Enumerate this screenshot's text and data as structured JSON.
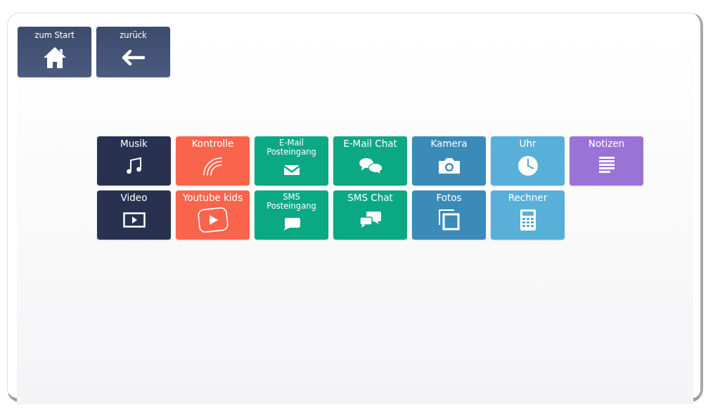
{
  "nav_buttons": [
    {
      "label": "zum Start",
      "kind": "home"
    },
    {
      "label": "zurück",
      "kind": "back"
    }
  ],
  "tile_rows": [
    [
      {
        "label": "Musik",
        "kind": "music",
        "color": "#283250"
      },
      {
        "label": "Kontrolle",
        "kind": "signal",
        "color": "#fb644c"
      },
      {
        "label": "E-Mail Posteingang",
        "kind": "mail",
        "color": "#0ba884"
      },
      {
        "label": "E-Mail Chat",
        "kind": "chat",
        "color": "#0ba884"
      },
      {
        "label": "Kamera",
        "kind": "camera",
        "color": "#3b8bb9"
      },
      {
        "label": "Uhr",
        "kind": "clock",
        "color": "#58b0d8"
      },
      {
        "label": "Notizen",
        "kind": "notes",
        "color": "#9b72d6"
      }
    ],
    [
      {
        "label": "Video",
        "kind": "video",
        "color": "#283250"
      },
      {
        "label": "Youtube kids",
        "kind": "play",
        "color": "#fb644c"
      },
      {
        "label": "SMS Posteingang",
        "kind": "sms",
        "color": "#0ba884"
      },
      {
        "label": "SMS Chat",
        "kind": "smschat",
        "color": "#0ba884"
      },
      {
        "label": "Fotos",
        "kind": "photos",
        "color": "#3b8bb9"
      },
      {
        "label": "Rechner",
        "kind": "calculator",
        "color": "#58b0d8"
      }
    ]
  ]
}
